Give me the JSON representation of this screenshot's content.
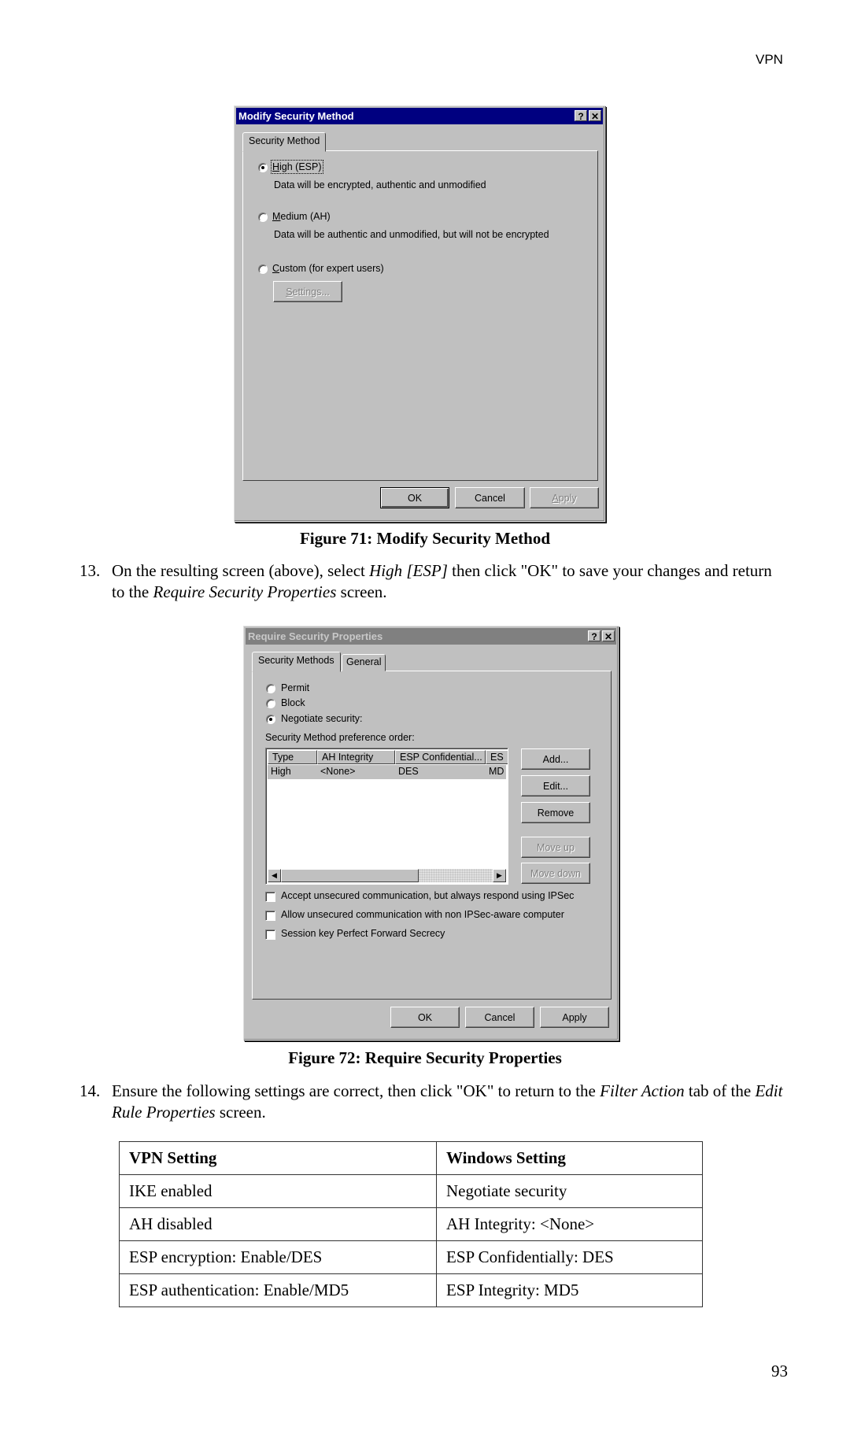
{
  "page": {
    "header_label": "VPN",
    "page_number": "93"
  },
  "figure71": {
    "dialog": {
      "title": "Modify Security Method",
      "help_button": "?",
      "close_button": "✕",
      "tab": "Security Method",
      "options": [
        {
          "label": "High (ESP)",
          "description": "Data will be encrypted, authentic and unmodified",
          "selected": true
        },
        {
          "label": "Medium (AH)",
          "description": "Data will be authentic and unmodified, but will not be encrypted",
          "selected": false
        },
        {
          "label": "Custom (for expert users)",
          "selected": false
        }
      ],
      "settings_button": "Settings...",
      "ok_button": "OK",
      "cancel_button": "Cancel",
      "apply_button": "Apply"
    },
    "caption": "Figure 71: Modify Security Method"
  },
  "step13": {
    "number": "13.",
    "text_before": "On the resulting screen (above), select ",
    "italic1": "High [ESP]",
    "text_middle": " then click \"OK\" to save your changes and return to the ",
    "italic2": "Require Security Properties",
    "text_after": " screen."
  },
  "figure72": {
    "dialog": {
      "title": "Require Security Properties",
      "help_button": "?",
      "close_button": "✕",
      "tabs": [
        "Security Methods",
        "General"
      ],
      "actions": [
        {
          "label": "Permit",
          "selected": false
        },
        {
          "label": "Block",
          "selected": false
        },
        {
          "label": "Negotiate security:",
          "selected": true
        }
      ],
      "preference_label": "Security Method preference order:",
      "list_columns": [
        "Type",
        "AH Integrity",
        "ESP Confidential...",
        "ES"
      ],
      "list_rows": [
        [
          "High",
          "<None>",
          "DES",
          "MD"
        ]
      ],
      "side_buttons": {
        "add": "Add...",
        "edit": "Edit...",
        "remove": "Remove",
        "move_up": "Move up",
        "move_down": "Move down"
      },
      "checkboxes": [
        {
          "label": "Accept unsecured communication, but always respond using IPSec",
          "checked": false
        },
        {
          "label": "Allow unsecured communication with non IPSec-aware computer",
          "checked": false
        },
        {
          "label": "Session key Perfect Forward Secrecy",
          "checked": false
        }
      ],
      "ok_button": "OK",
      "cancel_button": "Cancel",
      "apply_button": "Apply"
    },
    "caption": "Figure 72: Require Security Properties"
  },
  "step14": {
    "number": "14.",
    "text_before": "Ensure the following settings are correct, then click \"OK\" to return to the ",
    "italic1": "Filter Action",
    "text_middle": " tab of the ",
    "italic2": "Edit Rule Properties",
    "text_after": " screen."
  },
  "settings_table": {
    "headers": [
      "VPN Setting",
      "Windows Setting"
    ],
    "rows": [
      [
        "IKE enabled",
        "Negotiate security"
      ],
      [
        "AH disabled",
        "AH Integrity: <None>"
      ],
      [
        "ESP encryption: Enable/DES",
        "ESP Confidentially: DES"
      ],
      [
        "ESP authentication: Enable/MD5",
        "ESP Integrity: MD5"
      ]
    ]
  }
}
